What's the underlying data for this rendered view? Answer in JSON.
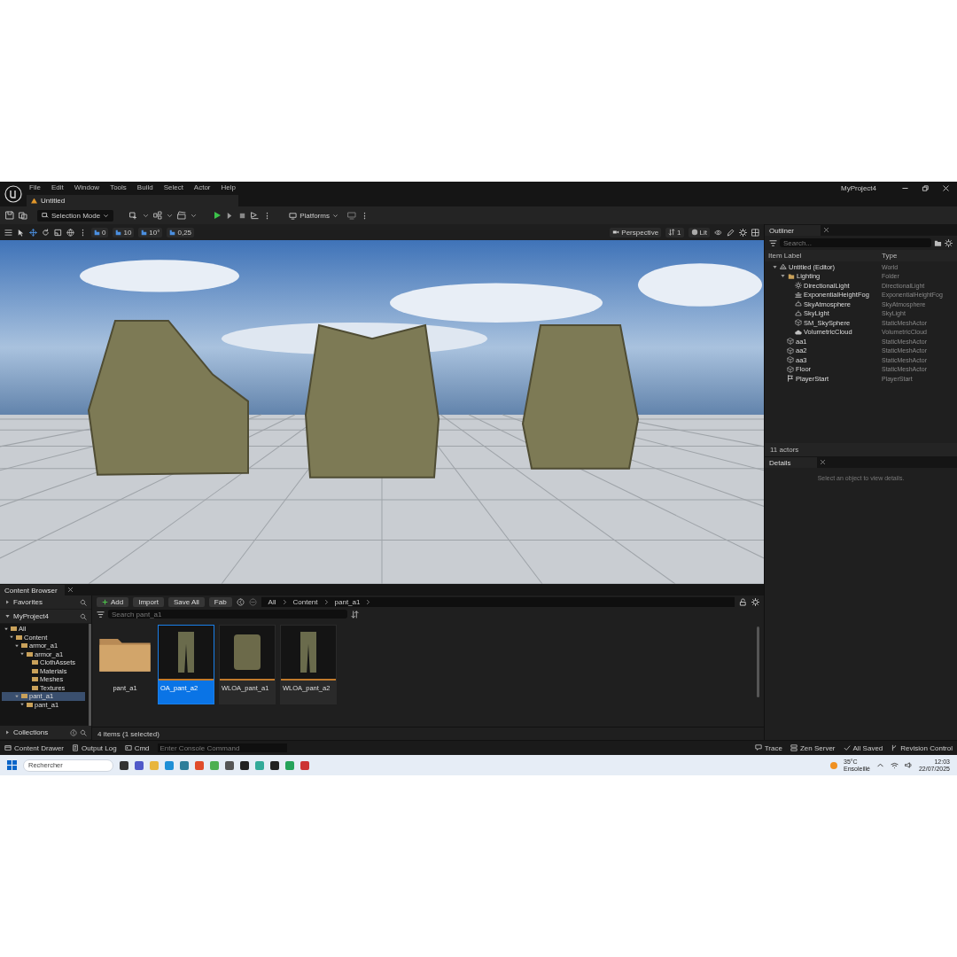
{
  "window": {
    "menu": [
      "File",
      "Edit",
      "Window",
      "Tools",
      "Build",
      "Select",
      "Actor",
      "Help"
    ],
    "tab": "Untitled",
    "project": "MyProject4"
  },
  "toolbar": {
    "mode": "Selection Mode",
    "platforms": "Platforms"
  },
  "viewport": {
    "snap_values": [
      "0",
      "10",
      "10°",
      "0,25"
    ],
    "view": "Perspective",
    "camera_speed": "1",
    "view_mode": "Lit"
  },
  "outliner": {
    "tab": "Outliner",
    "search": {
      "placeholder": "Search..."
    },
    "columns": [
      "Item Label",
      "Type"
    ],
    "rows": [
      {
        "label": "Untitled (Editor)",
        "type": "World",
        "kind": "world",
        "expanded": true,
        "children": [
          {
            "label": "Lighting",
            "type": "Folder",
            "kind": "folder",
            "expanded": true,
            "children": [
              {
                "label": "DirectionalLight",
                "type": "DirectionalLight",
                "kind": "light"
              },
              {
                "label": "ExponentialHeightFog",
                "type": "ExponentialHeightFog",
                "kind": "fog"
              },
              {
                "label": "SkyAtmosphere",
                "type": "SkyAtmosphere",
                "kind": "sky"
              },
              {
                "label": "SkyLight",
                "type": "SkyLight",
                "kind": "sky"
              },
              {
                "label": "SM_SkySphere",
                "type": "StaticMeshActor",
                "kind": "mesh"
              },
              {
                "label": "VolumetricCloud",
                "type": "VolumetricCloud",
                "kind": "cloud"
              }
            ]
          },
          {
            "label": "aa1",
            "type": "StaticMeshActor",
            "kind": "mesh"
          },
          {
            "label": "aa2",
            "type": "StaticMeshActor",
            "kind": "mesh"
          },
          {
            "label": "aa3",
            "type": "StaticMeshActor",
            "kind": "mesh"
          },
          {
            "label": "Floor",
            "type": "StaticMeshActor",
            "kind": "mesh"
          },
          {
            "label": "PlayerStart",
            "type": "PlayerStart",
            "kind": "player"
          }
        ]
      }
    ],
    "count": "11 actors"
  },
  "details": {
    "tab": "Details",
    "empty_text": "Select an object to view details."
  },
  "content_browser": {
    "tab": "Content Browser",
    "favorites": "Favorites",
    "project": "MyProject4",
    "collections": "Collections",
    "tree": [
      {
        "label": "All",
        "selected": false,
        "expanded": true,
        "children": [
          {
            "label": "Content",
            "selected": false,
            "expanded": true,
            "children": [
              {
                "label": "armor_a1",
                "selected": false,
                "expanded": true,
                "children": [
                  {
                    "label": "armor_a1",
                    "selected": false,
                    "expanded": true,
                    "children": [
                      {
                        "label": "ClothAssets",
                        "selected": false
                      },
                      {
                        "label": "Materials",
                        "selected": false
                      },
                      {
                        "label": "Meshes",
                        "selected": false
                      },
                      {
                        "label": "Textures",
                        "selected": false
                      }
                    ]
                  }
                ]
              },
              {
                "label": "pant_a1",
                "selected": true,
                "expanded": true,
                "children": [
                  {
                    "label": "pant_a1",
                    "selected": false,
                    "expanded": true
                  }
                ]
              }
            ]
          }
        ]
      }
    ],
    "buttons": [
      "Add",
      "Import",
      "Save All",
      "Fab"
    ],
    "breadcrumb": [
      "All",
      "Content",
      "pant_a1"
    ],
    "search": {
      "placeholder": "Search pant_a1"
    },
    "assets": [
      {
        "name": "pant_a1",
        "kind": "folder",
        "selected": false
      },
      {
        "name": "OA_pant_a2",
        "kind": "pants",
        "selected": true
      },
      {
        "name": "WLOA_pant_a1",
        "kind": "vest",
        "selected": false
      },
      {
        "name": "WLOA_pant_a2",
        "kind": "pants",
        "selected": false
      }
    ],
    "status": "4 items (1 selected)"
  },
  "status_bar": {
    "left": [
      "Content Drawer",
      "Output Log"
    ],
    "cmd": "Cmd",
    "console": {
      "placeholder": "Enter Console Command"
    },
    "right": [
      "Trace",
      "Zen Server",
      "All Saved",
      "Revision Control"
    ]
  },
  "taskbar": {
    "search": {
      "placeholder": "Rechercher"
    },
    "temperature": "35°C",
    "weather": "Ensoleillé",
    "time": "12:03",
    "date": "22/07/2025"
  }
}
